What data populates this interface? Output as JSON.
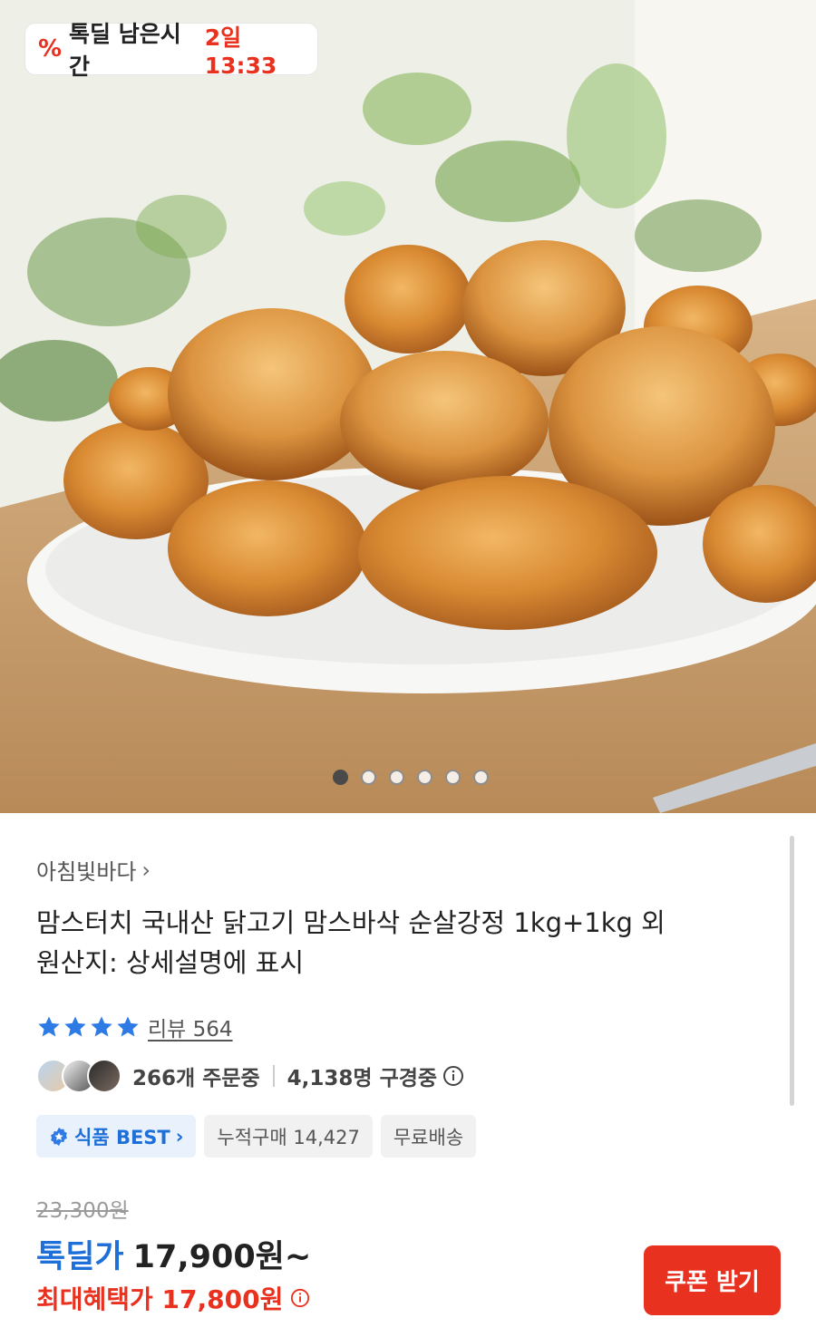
{
  "deal_timer": {
    "icon": "percent-icon",
    "label": "톡딜 남은시간",
    "remaining": "2일 13:33"
  },
  "carousel": {
    "total": 6,
    "active_index": 0
  },
  "product": {
    "seller": "아침빛바다",
    "title_line1": "맘스터치 국내산 닭고기 맘스바삭 순살강정 1kg+1kg 외",
    "title_line2": "원산지: 상세설명에 표시",
    "rating_stars": 4,
    "review_label": "리뷰 564",
    "orders": "266개 주문중",
    "viewers": "4,138명 구경중"
  },
  "badges": {
    "best": "식품 BEST",
    "cumulative": "누적구매 14,427",
    "free_shipping": "무료배송"
  },
  "price": {
    "original": "23,300원",
    "deal_label": "톡딜가",
    "deal_value": "17,900원~",
    "max_benefit": "최대혜택가 17,800원"
  },
  "coupon_button": "쿠폰 받기",
  "colors": {
    "accent_red": "#e8321f",
    "accent_blue": "#1f6fd9"
  }
}
